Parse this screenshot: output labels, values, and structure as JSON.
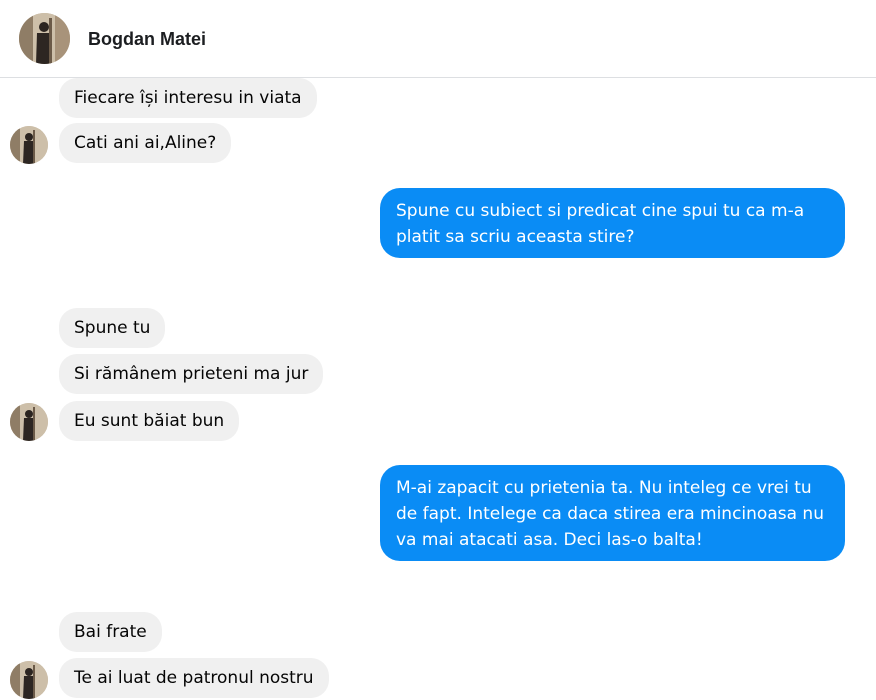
{
  "header": {
    "contact_name": "Bogdan Matei"
  },
  "messages": [
    {
      "side": "incoming",
      "text": "Fiecare își interesu in viata"
    },
    {
      "side": "incoming",
      "text": "Cati ani ai,Aline?"
    },
    {
      "side": "outgoing",
      "text": "Spune cu subiect si predicat cine spui tu ca m-a platit sa scriu aceasta stire?"
    },
    {
      "side": "incoming",
      "text": "Spune tu"
    },
    {
      "side": "incoming",
      "text": "Si rămânem prieteni ma jur"
    },
    {
      "side": "incoming",
      "text": "Eu sunt băiat bun"
    },
    {
      "side": "outgoing",
      "text": "M-ai zapacit cu prietenia ta. Nu inteleg ce vrei tu de fapt. Intelege ca daca stirea era mincinoasa nu va mai atacati asa. Deci las-o balta!"
    },
    {
      "side": "incoming",
      "text": "Bai frate"
    },
    {
      "side": "incoming",
      "text": "Te ai luat de patronul nostru"
    }
  ],
  "colors": {
    "incoming_bubble": "#f0f0f0",
    "outgoing_bubble": "#0a8cf5",
    "divider": "#dddfe2"
  },
  "icons": {
    "contact_avatar": "user-photo"
  }
}
